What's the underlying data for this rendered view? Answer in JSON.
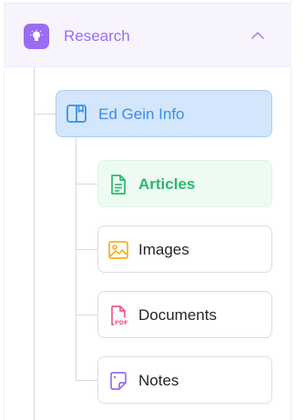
{
  "section": {
    "title": "Research",
    "expanded": true,
    "icon": "lightbulb-icon",
    "accent_color": "#9b6cf2"
  },
  "root_node": {
    "label": "Ed Gein Info",
    "icon": "book-icon",
    "color": "#3b8fe3"
  },
  "children": [
    {
      "label": "Articles",
      "icon": "document-icon",
      "active": true,
      "color": "#2bb86c"
    },
    {
      "label": "Images",
      "icon": "image-icon",
      "active": false,
      "color": "#f2b21c"
    },
    {
      "label": "Documents",
      "icon": "pdf-icon",
      "active": false,
      "color": "#ee5a8b"
    },
    {
      "label": "Notes",
      "icon": "note-icon",
      "active": false,
      "color": "#9b6cf2"
    }
  ]
}
